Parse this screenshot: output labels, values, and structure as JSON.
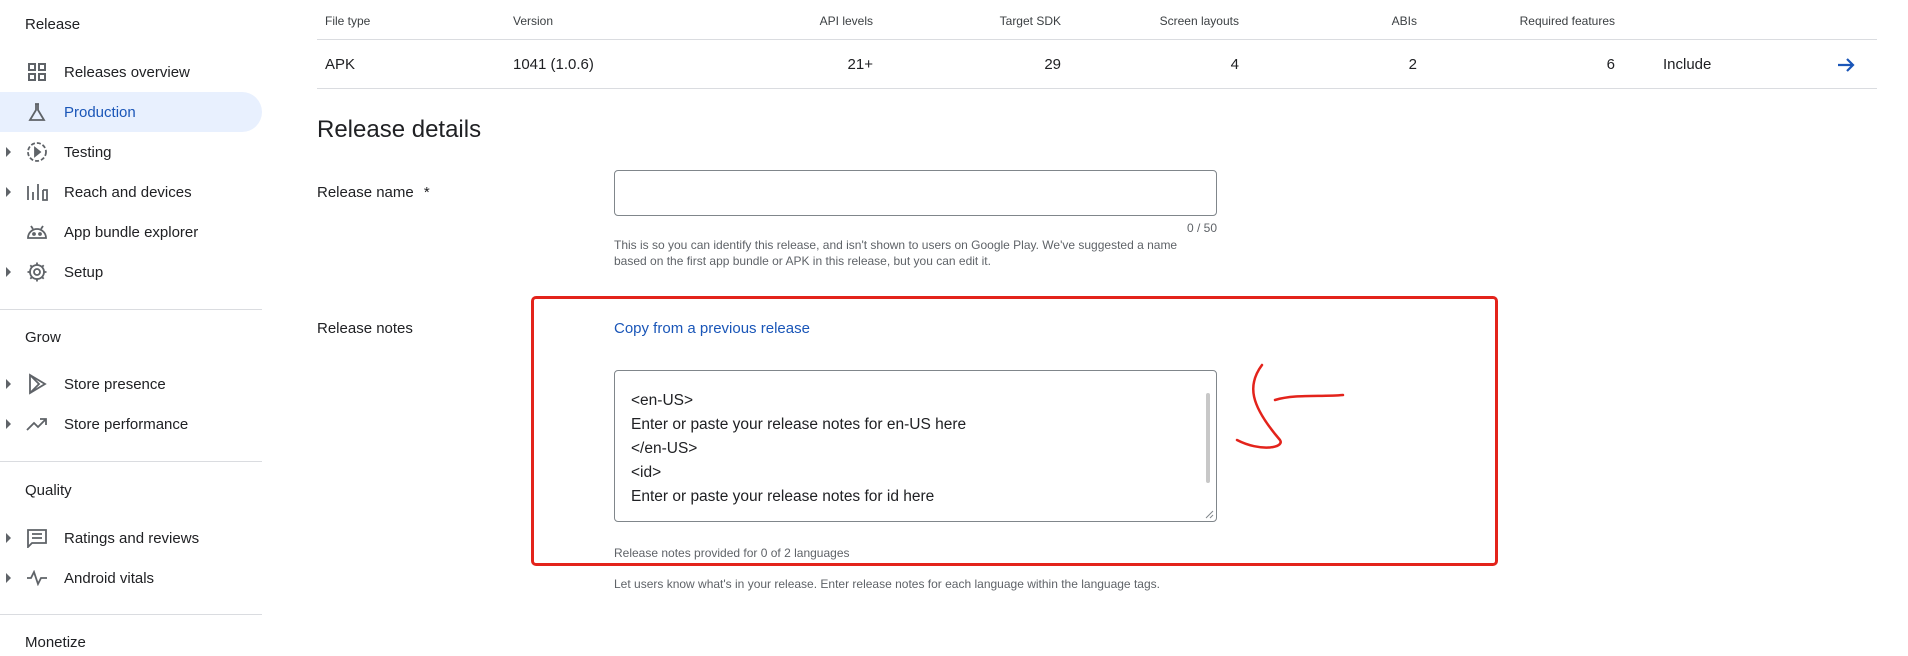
{
  "sidebar": {
    "sections": [
      {
        "title": "Release",
        "items": [
          {
            "label": "Releases overview",
            "icon": "grid-icon",
            "expandable": false,
            "active": false
          },
          {
            "label": "Production",
            "icon": "flask-icon",
            "expandable": false,
            "active": true
          },
          {
            "label": "Testing",
            "icon": "play-circle-icon",
            "expandable": true,
            "active": false
          },
          {
            "label": "Reach and devices",
            "icon": "bar-chart-icon",
            "expandable": true,
            "active": false
          },
          {
            "label": "App bundle explorer",
            "icon": "android-icon",
            "expandable": false,
            "active": false
          },
          {
            "label": "Setup",
            "icon": "gear-icon",
            "expandable": true,
            "active": false
          }
        ]
      },
      {
        "title": "Grow",
        "items": [
          {
            "label": "Store presence",
            "icon": "play-triangle-icon",
            "expandable": true,
            "active": false
          },
          {
            "label": "Store performance",
            "icon": "trending-up-icon",
            "expandable": true,
            "active": false
          }
        ]
      },
      {
        "title": "Quality",
        "items": [
          {
            "label": "Ratings and reviews",
            "icon": "comment-icon",
            "expandable": true,
            "active": false
          },
          {
            "label": "Android vitals",
            "icon": "vitals-icon",
            "expandable": true,
            "active": false
          }
        ]
      },
      {
        "title": "Monetize",
        "items": []
      }
    ]
  },
  "table": {
    "headers": [
      "File type",
      "Version",
      "API levels",
      "Target SDK",
      "Screen layouts",
      "ABIs",
      "Required features"
    ],
    "row": {
      "file_type": "APK",
      "version": "1041 (1.0.6)",
      "api_levels": "21+",
      "target_sdk": "29",
      "screen_layouts": "4",
      "abis": "2",
      "required_features": "6",
      "action": "Include"
    }
  },
  "release_details": {
    "title": "Release details",
    "release_name": {
      "label": "Release name",
      "required_marker": "*",
      "value": "",
      "counter": "0 / 50",
      "helper_line1": "This is so you can identify this release, and isn't shown to users on Google Play. We've suggested a name",
      "helper_line2": "based on the first app bundle or APK in this release, but you can edit it."
    },
    "release_notes": {
      "label": "Release notes",
      "copy_link": "Copy from a previous release",
      "lines": [
        "<en-US>",
        "Enter or paste your release notes for en-US here",
        "</en-US>",
        "<id>",
        "Enter or paste your release notes for id here"
      ],
      "status": "Release notes provided for 0 of 2 languages",
      "helper": "Let users know what's in your release. Enter release notes for each language within the language tags."
    }
  },
  "colors": {
    "accent": "#1a56b8",
    "active_bg": "#e8f0fe",
    "annotation": "#e3231b"
  }
}
